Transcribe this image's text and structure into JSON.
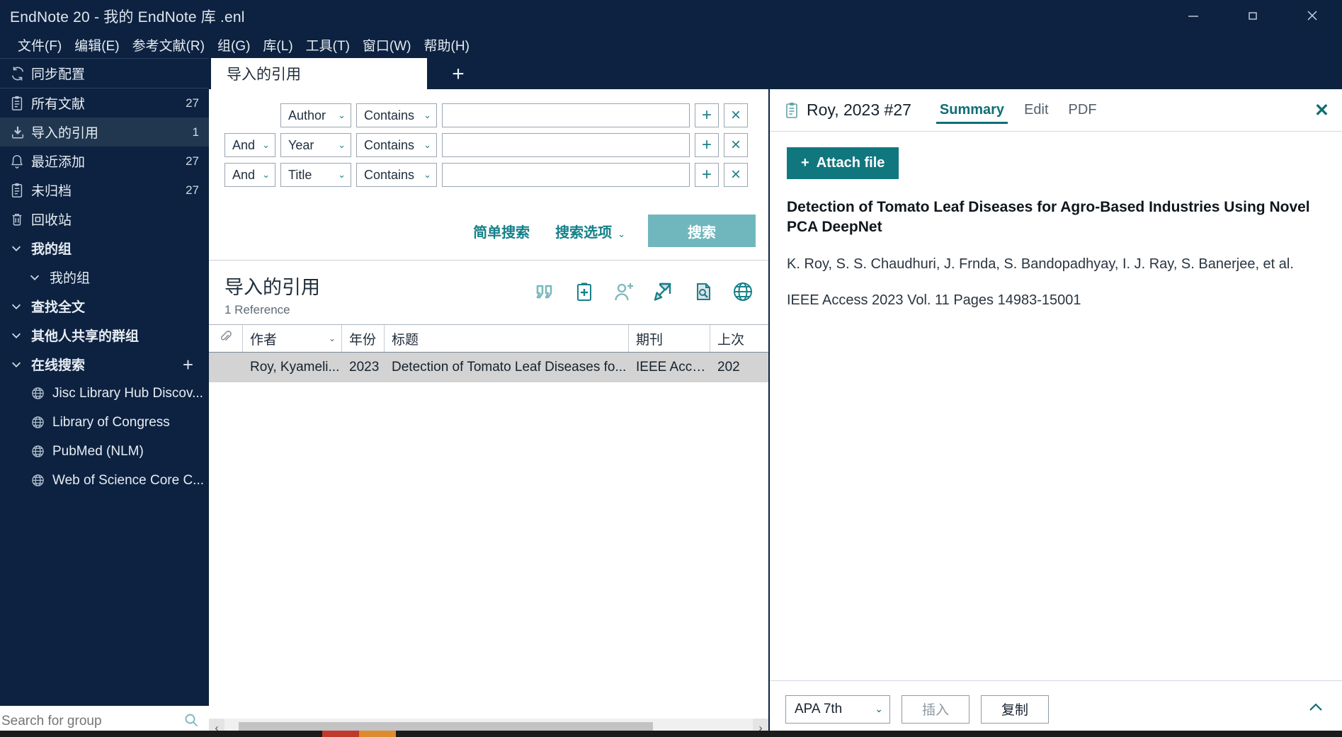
{
  "window": {
    "title": "EndNote 20 - 我的 EndNote 库 .enl",
    "minimize": "minimize-icon",
    "restore": "restore-icon",
    "close": "close-icon"
  },
  "menubar": {
    "items": [
      {
        "label": "文件(F)"
      },
      {
        "label": "编辑(E)"
      },
      {
        "label": "参考文献(R)"
      },
      {
        "label": "组(G)"
      },
      {
        "label": "库(L)"
      },
      {
        "label": "工具(T)"
      },
      {
        "label": "窗口(W)"
      },
      {
        "label": "帮助(H)"
      }
    ]
  },
  "sidebar": {
    "items": [
      {
        "label": "同步配置",
        "count": "",
        "icon": "sync-icon"
      },
      {
        "label": "所有文献",
        "count": "27",
        "icon": "clipboard-icon"
      },
      {
        "label": "导入的引用",
        "count": "1",
        "icon": "import-icon"
      },
      {
        "label": "最近添加",
        "count": "27",
        "icon": "bell-icon"
      },
      {
        "label": "未归档",
        "count": "27",
        "icon": "clipboard-icon"
      },
      {
        "label": "回收站",
        "count": "",
        "icon": "trash-icon"
      }
    ],
    "groups": [
      {
        "label": "我的组",
        "icon": "chevron-down-icon",
        "bold": true
      },
      {
        "label": "我的组",
        "icon": "chevron-down-icon",
        "bold": false,
        "sub": true
      },
      {
        "label": "查找全文",
        "icon": "chevron-down-icon",
        "bold": true
      },
      {
        "label": "其他人共享的群组",
        "icon": "chevron-down-icon",
        "bold": true
      },
      {
        "label": "在线搜索",
        "icon": "chevron-down-icon",
        "bold": true,
        "plus": "+"
      }
    ],
    "online_sources": [
      {
        "label": "Jisc Library Hub Discov...",
        "icon": "globe-icon"
      },
      {
        "label": "Library of Congress",
        "icon": "globe-icon"
      },
      {
        "label": "PubMed (NLM)",
        "icon": "globe-icon"
      },
      {
        "label": "Web of Science Core C...",
        "icon": "globe-icon"
      }
    ],
    "search": {
      "placeholder": "Search for group",
      "value": "",
      "icon": "search-icon"
    }
  },
  "tabs": {
    "active_label": "导入的引用",
    "add_label": "+"
  },
  "search_panel": {
    "rows": [
      {
        "bool": "",
        "field": "Author",
        "operator": "Contains",
        "value": "",
        "add": "+",
        "remove": "×"
      },
      {
        "bool": "And",
        "field": "Year",
        "operator": "Contains",
        "value": "",
        "add": "+",
        "remove": "×"
      },
      {
        "bool": "And",
        "field": "Title",
        "operator": "Contains",
        "value": "",
        "add": "+",
        "remove": "×"
      }
    ],
    "simple_search": "简单搜索",
    "search_options": "搜索选项",
    "search_button": "搜索"
  },
  "reference_list": {
    "title": "导入的引用",
    "subtitle": "1 Reference",
    "toolbar_icons": [
      {
        "name": "quote-icon"
      },
      {
        "name": "new-reference-icon"
      },
      {
        "name": "add-person-icon"
      },
      {
        "name": "share-arrow-icon"
      },
      {
        "name": "find-fulltext-icon"
      },
      {
        "name": "globe-icon"
      }
    ],
    "columns": [
      "",
      "作者",
      "年份",
      "标题",
      "期刊",
      "上次"
    ],
    "rows": [
      {
        "attachment": "",
        "author": "Roy, Kyameli...",
        "year": "2023",
        "title": "Detection of Tomato Leaf Diseases fo...",
        "journal": "IEEE Access",
        "last": "202"
      }
    ],
    "hscroll": {
      "left": "‹",
      "right": "›"
    }
  },
  "detail_panel": {
    "record_label": "Roy, 2023 #27",
    "tabs": [
      {
        "label": "Summary",
        "active": true
      },
      {
        "label": "Edit",
        "active": false
      },
      {
        "label": "PDF",
        "active": false
      }
    ],
    "close": "✕",
    "attach_file": "Attach file",
    "attach_plus": "+",
    "reference": {
      "title": "Detection of Tomato Leaf Diseases for Agro-Based Industries Using Novel PCA DeepNet",
      "authors": "K. Roy, S. S. Chaudhuri, J. Frnda, S. Bandopadhyay, I. J. Ray, S. Banerjee, et al.",
      "source": "IEEE Access 2023 Vol. 11 Pages 14983-15001"
    },
    "footer": {
      "style": "APA 7th",
      "insert": "插入",
      "copy": "复制",
      "collapse": "chevron-up-icon"
    }
  },
  "colors": {
    "chrome_dark": "#0d2240",
    "accent_teal": "#14808a",
    "attach_green": "#11777f",
    "search_button": "#70b7bd",
    "row_selected": "#d3d3d3"
  }
}
